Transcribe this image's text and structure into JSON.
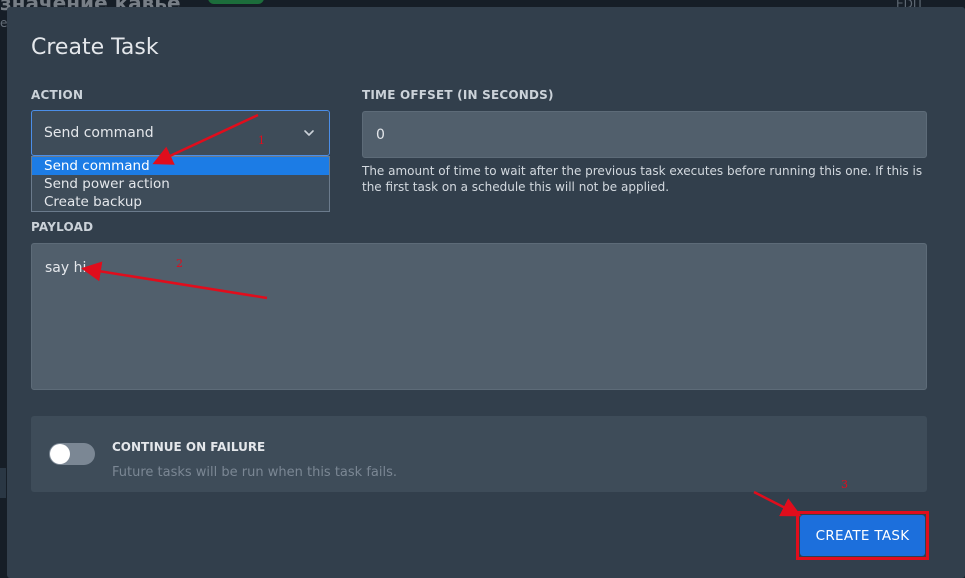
{
  "background": {
    "title": "значение кавье",
    "sub": "е",
    "edit": "EDIT"
  },
  "modal": {
    "title": "Create Task",
    "action": {
      "label": "ACTION",
      "selected": "Send command",
      "options": [
        "Send command",
        "Send power action",
        "Create backup"
      ]
    },
    "time_offset": {
      "label": "TIME OFFSET (IN SECONDS)",
      "value": "0",
      "help": "The amount of time to wait after the previous task executes before running this one. If this is the first task on a schedule this will not be applied."
    },
    "payload": {
      "label": "PAYLOAD",
      "value": "say hi"
    },
    "continue_on_failure": {
      "title": "CONTINUE ON FAILURE",
      "description": "Future tasks will be run when this task fails.",
      "enabled": false
    },
    "submit_label": "CREATE TASK"
  },
  "annotations": {
    "labels": [
      "1",
      "2",
      "3"
    ],
    "color": "#e00d1c"
  },
  "colors": {
    "accent": "#1c7ce5",
    "modal_bg": "#323f4c",
    "input_bg": "#515f6c"
  }
}
